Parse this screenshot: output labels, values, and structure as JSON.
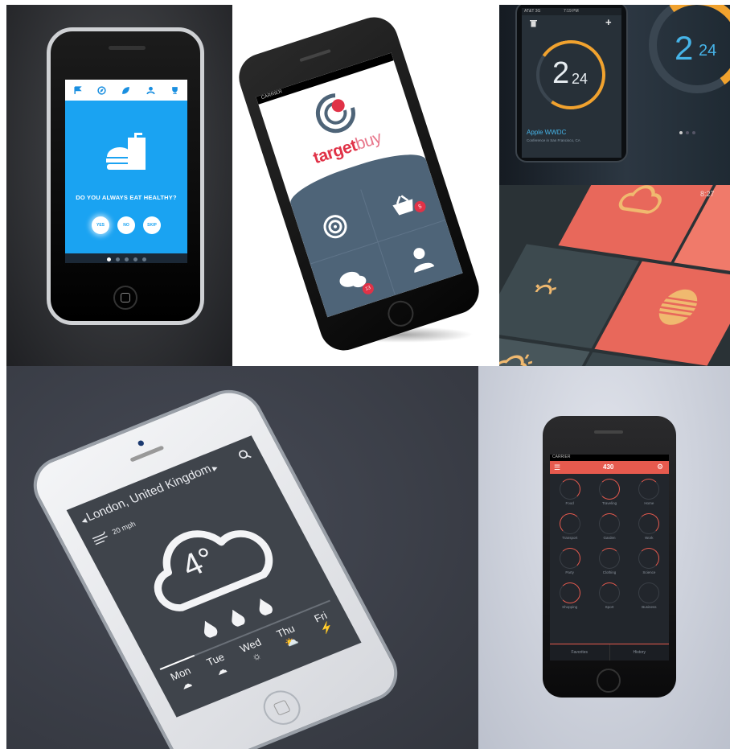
{
  "panel1": {
    "question": "DO YOU ALWAYS EAT HEALTHY?",
    "buttons": [
      "YES",
      "NO",
      "SKIP"
    ],
    "nav_icons": [
      "flag-icon",
      "compass-icon",
      "leaf-icon",
      "cyclist-icon",
      "trophy-icon"
    ],
    "colors": {
      "screen": "#1aa3f2",
      "bg": "#3a3c40"
    }
  },
  "panel2": {
    "carrier": "CARRIER",
    "brand_prefix": "target",
    "brand_suffix": "buy",
    "badges": [
      "5",
      "13"
    ],
    "colors": {
      "accent": "#e03247",
      "tile": "#4e6478"
    }
  },
  "panel3": {
    "carrier": "AT&T 3G",
    "time": "7:19 PM",
    "big_number": "2",
    "small_number": "24",
    "event_title": "Apple WWDC",
    "event_subtitle": "Conference in San Francisco, CA",
    "colors": {
      "ring": "#f1a22e",
      "screen": "#273038"
    }
  },
  "panel4": {
    "time": "8:27",
    "colors": {
      "coral": "#e8685b",
      "tile_dark": "#3d4a4f",
      "icon": "#f0b96f"
    }
  },
  "panel5": {
    "location": "London, United Kingdom",
    "wind": "20 mph",
    "temperature": "4°",
    "days": [
      "Mon",
      "Tue",
      "Wed",
      "Thu",
      "Fri"
    ],
    "colors": {
      "screen": "#3f444b",
      "bg": "#383b44"
    }
  },
  "panel6": {
    "carrier": "CARRIER",
    "header_value": "430",
    "categories": [
      "Food",
      "Traveling",
      "Home",
      "Transport",
      "Garden",
      "Work",
      "Party",
      "Clothing",
      "Science",
      "Shopping",
      "Sport",
      "Business"
    ],
    "tabs": [
      "Favorites",
      "History"
    ],
    "colors": {
      "header": "#e65a4e",
      "screen": "#22262c",
      "bg": "#c9cdd8"
    }
  }
}
